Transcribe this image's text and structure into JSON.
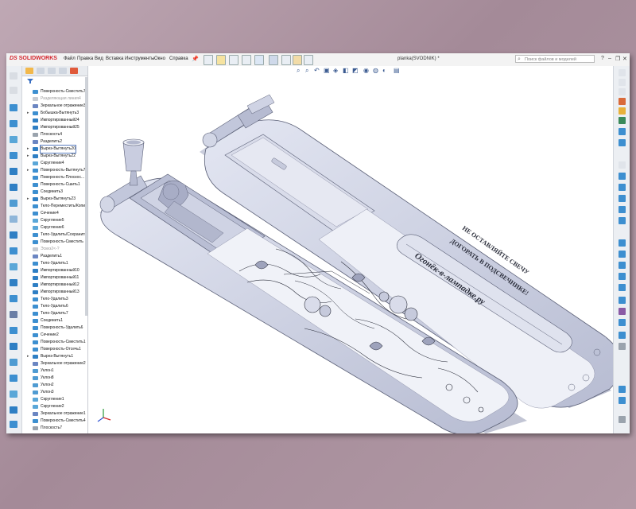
{
  "app": {
    "logo_ds": "DS",
    "logo_text": "SOLIDWORKS",
    "menus": [
      "Файл",
      "Правка",
      "Вид",
      "Вставка",
      "Инструменты",
      "Окно",
      "Справка"
    ],
    "document_title": "planka(SVODNIK) *",
    "search_placeholder": "Поиск файлов и моделей",
    "window_controls": [
      "?",
      "–",
      "❐",
      "✕"
    ]
  },
  "feature_tree": {
    "items": [
      {
        "label": "Поверхность-Сместить7",
        "icon": "surface-offset-icon",
        "dim": false,
        "expand": false,
        "selected": false
      },
      {
        "label": "Разделяющая линия4",
        "icon": "split-line-icon",
        "dim": true,
        "expand": false,
        "selected": false
      },
      {
        "label": "Зеркальное отражение3",
        "icon": "mirror-icon",
        "dim": false,
        "expand": false,
        "selected": false
      },
      {
        "label": "Бобышка-Вытянуть3",
        "icon": "boss-extrude-icon",
        "dim": false,
        "expand": true,
        "selected": false
      },
      {
        "label": "Импортированный24",
        "icon": "imported-body-icon",
        "dim": false,
        "expand": false,
        "selected": false
      },
      {
        "label": "Импортированный25",
        "icon": "imported-body-icon",
        "dim": false,
        "expand": false,
        "selected": false
      },
      {
        "label": "Плоскость4",
        "icon": "plane-icon",
        "dim": false,
        "expand": false,
        "selected": false
      },
      {
        "label": "Разделить2",
        "icon": "split-icon",
        "dim": false,
        "expand": false,
        "selected": false
      },
      {
        "label": "Вырез-Вытянуть20",
        "icon": "cut-extrude-icon",
        "dim": false,
        "expand": true,
        "selected": true
      },
      {
        "label": "Вырез-Вытянуть22",
        "icon": "cut-extrude-icon",
        "dim": false,
        "expand": true,
        "selected": false
      },
      {
        "label": "Скругление4",
        "icon": "fillet-icon",
        "dim": false,
        "expand": false,
        "selected": false
      },
      {
        "label": "Поверхность-Вытянуть7",
        "icon": "surface-extrude-icon",
        "dim": false,
        "expand": true,
        "selected": false
      },
      {
        "label": "Поверхность-Плоскос...",
        "icon": "planar-surface-icon",
        "dim": false,
        "expand": false,
        "selected": false
      },
      {
        "label": "Поверхность-Сшить1",
        "icon": "knit-surface-icon",
        "dim": false,
        "expand": false,
        "selected": false
      },
      {
        "label": "Соединить3",
        "icon": "combine-icon",
        "dim": false,
        "expand": false,
        "selected": false
      },
      {
        "label": "Вырез-Вытянуть23",
        "icon": "cut-extrude-icon",
        "dim": false,
        "expand": true,
        "selected": false
      },
      {
        "label": "Тело-Переместить/Копи",
        "icon": "move-body-icon",
        "dim": false,
        "expand": false,
        "selected": false
      },
      {
        "label": "Сечение4",
        "icon": "section-icon",
        "dim": false,
        "expand": false,
        "selected": false
      },
      {
        "label": "Скругление5",
        "icon": "fillet-icon",
        "dim": false,
        "expand": false,
        "selected": false
      },
      {
        "label": "Скругление6",
        "icon": "fillet-icon",
        "dim": false,
        "expand": false,
        "selected": false
      },
      {
        "label": "Тело-Удалить/Сохранить",
        "icon": "delete-body-icon",
        "dim": false,
        "expand": false,
        "selected": false
      },
      {
        "label": "Поверхность-Сместить",
        "icon": "surface-offset-icon",
        "dim": false,
        "expand": false,
        "selected": false
      },
      {
        "label": "Эскиз2<-?",
        "icon": "sketch-icon",
        "dim": true,
        "expand": false,
        "selected": false
      },
      {
        "label": "Разделить1",
        "icon": "split-icon",
        "dim": false,
        "expand": false,
        "selected": false
      },
      {
        "label": "Тело-Удалить1",
        "icon": "delete-body-icon",
        "dim": false,
        "expand": false,
        "selected": false
      },
      {
        "label": "Импортированный10",
        "icon": "imported-body-icon",
        "dim": false,
        "expand": false,
        "selected": false
      },
      {
        "label": "Импортированный11",
        "icon": "imported-body-icon",
        "dim": false,
        "expand": false,
        "selected": false
      },
      {
        "label": "Импортированный12",
        "icon": "imported-body-icon",
        "dim": false,
        "expand": false,
        "selected": false
      },
      {
        "label": "Импортированный13",
        "icon": "imported-body-icon",
        "dim": false,
        "expand": false,
        "selected": false
      },
      {
        "label": "Тело-Удалить3",
        "icon": "delete-body-icon",
        "dim": false,
        "expand": false,
        "selected": false
      },
      {
        "label": "Тело-Удалить6",
        "icon": "delete-body-icon",
        "dim": false,
        "expand": false,
        "selected": false
      },
      {
        "label": "Тело-Удалить7",
        "icon": "delete-body-icon",
        "dim": false,
        "expand": false,
        "selected": false
      },
      {
        "label": "Соединить1",
        "icon": "combine-icon",
        "dim": false,
        "expand": false,
        "selected": false
      },
      {
        "label": "Поверхность-Удалить6",
        "icon": "delete-face-icon",
        "dim": false,
        "expand": false,
        "selected": false
      },
      {
        "label": "Сечение2",
        "icon": "section-icon",
        "dim": false,
        "expand": false,
        "selected": false
      },
      {
        "label": "Поверхность-Сместить1",
        "icon": "surface-offset-icon",
        "dim": false,
        "expand": false,
        "selected": false
      },
      {
        "label": "Поверхность-Отсечь1",
        "icon": "surface-trim-icon",
        "dim": false,
        "expand": false,
        "selected": false
      },
      {
        "label": "Вырез-Вытянуть1",
        "icon": "cut-extrude-icon",
        "dim": false,
        "expand": true,
        "selected": false
      },
      {
        "label": "Зеркальное отражение2",
        "icon": "mirror-icon",
        "dim": false,
        "expand": false,
        "selected": false
      },
      {
        "label": "Уклон1",
        "icon": "draft-icon",
        "dim": false,
        "expand": false,
        "selected": false
      },
      {
        "label": "Уклон8",
        "icon": "draft-icon",
        "dim": false,
        "expand": false,
        "selected": false
      },
      {
        "label": "Уклон2",
        "icon": "draft-icon",
        "dim": false,
        "expand": false,
        "selected": false
      },
      {
        "label": "Уклон3",
        "icon": "draft-icon",
        "dim": false,
        "expand": false,
        "selected": false
      },
      {
        "label": "Скругление1",
        "icon": "fillet-icon",
        "dim": false,
        "expand": false,
        "selected": false
      },
      {
        "label": "Скругление2",
        "icon": "fillet-icon",
        "dim": false,
        "expand": false,
        "selected": false
      },
      {
        "label": "Зеркальное отражение1",
        "icon": "mirror-icon",
        "dim": false,
        "expand": false,
        "selected": false
      },
      {
        "label": "Поверхность-Сместить4",
        "icon": "surface-offset-icon",
        "dim": false,
        "expand": false,
        "selected": false
      },
      {
        "label": "Плоскость7",
        "icon": "plane-icon",
        "dim": false,
        "expand": false,
        "selected": false
      }
    ]
  },
  "model": {
    "engraving_line1": "НЕ ОСТАВЛЯЙТЕ СВЕЧУ",
    "engraving_line2": "ДОГОРАТЬ В ПОДСВЕЧНИКЕ!",
    "engraving_line3": "Огонёк-в-лампадке.ру"
  },
  "colors": {
    "accent": "#d3222a",
    "model_body": "#c9cde0",
    "model_edge": "#5b6077",
    "selection": "#5a7dbe"
  }
}
